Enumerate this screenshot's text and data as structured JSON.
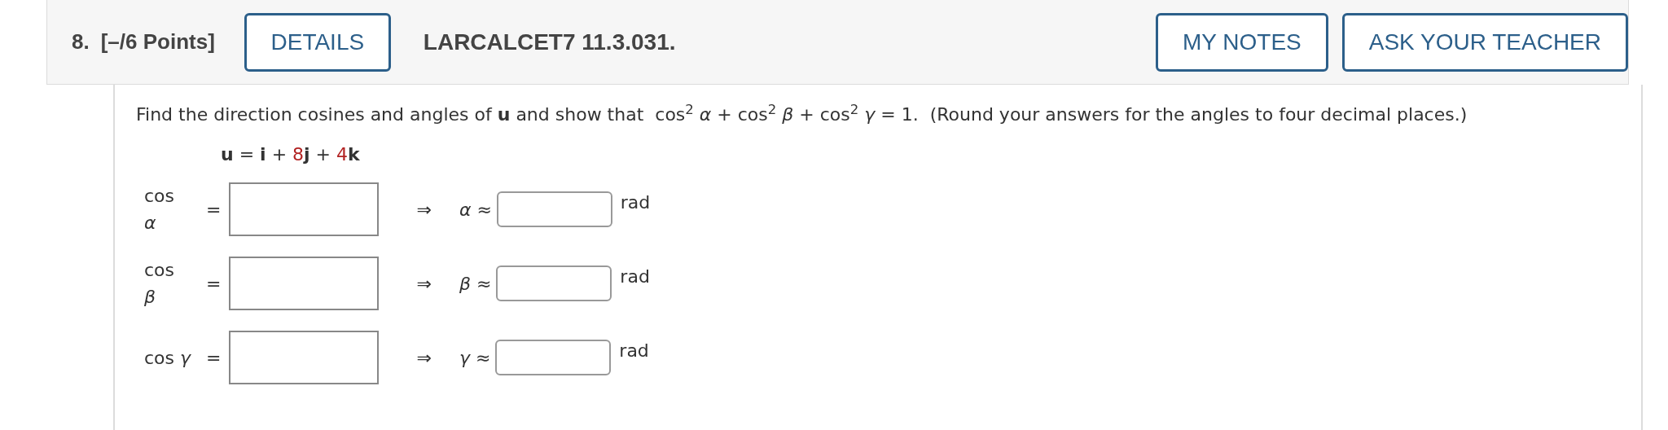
{
  "header": {
    "number": "8.",
    "points": "[–/6 Points]",
    "details_button": "DETAILS",
    "problem_id": "LARCALCET7 11.3.031.",
    "buttons": [
      "MY NOTES",
      "ASK YOUR TEACHER"
    ]
  },
  "question": {
    "prompt": "Find the direction cosines and angles of **u** and show that  cos$^{2}$ *α* + cos$^{2}$ *β* + cos$^{2}$ *γ* = 1.  (Round your answers for the angles to four decimal places.)",
    "formula": [
      {
        "text": "u",
        "kind": "vector"
      },
      {
        "text": " = ",
        "kind": "operator"
      },
      {
        "text": "i",
        "kind": "vector"
      },
      {
        "text": " + ",
        "kind": "operator"
      },
      {
        "text": "8",
        "kind": "coefficient"
      },
      {
        "text": "j",
        "kind": "vector"
      },
      {
        "text": " + ",
        "kind": "operator"
      },
      {
        "text": "4",
        "kind": "coefficient"
      },
      {
        "text": "k",
        "kind": "vector"
      }
    ],
    "rows": [
      {
        "label": "cos *α*",
        "equals": "=",
        "arrow": "⇒",
        "angle": "*α* ≈",
        "unit": "rad"
      },
      {
        "label": "cos *β*",
        "equals": "=",
        "arrow": "⇒",
        "angle": "*β* ≈",
        "unit": "rad"
      },
      {
        "label": "cos *γ*",
        "equals": "=",
        "arrow": "⇒",
        "angle": "*γ* ≈",
        "unit": "rad"
      }
    ]
  }
}
